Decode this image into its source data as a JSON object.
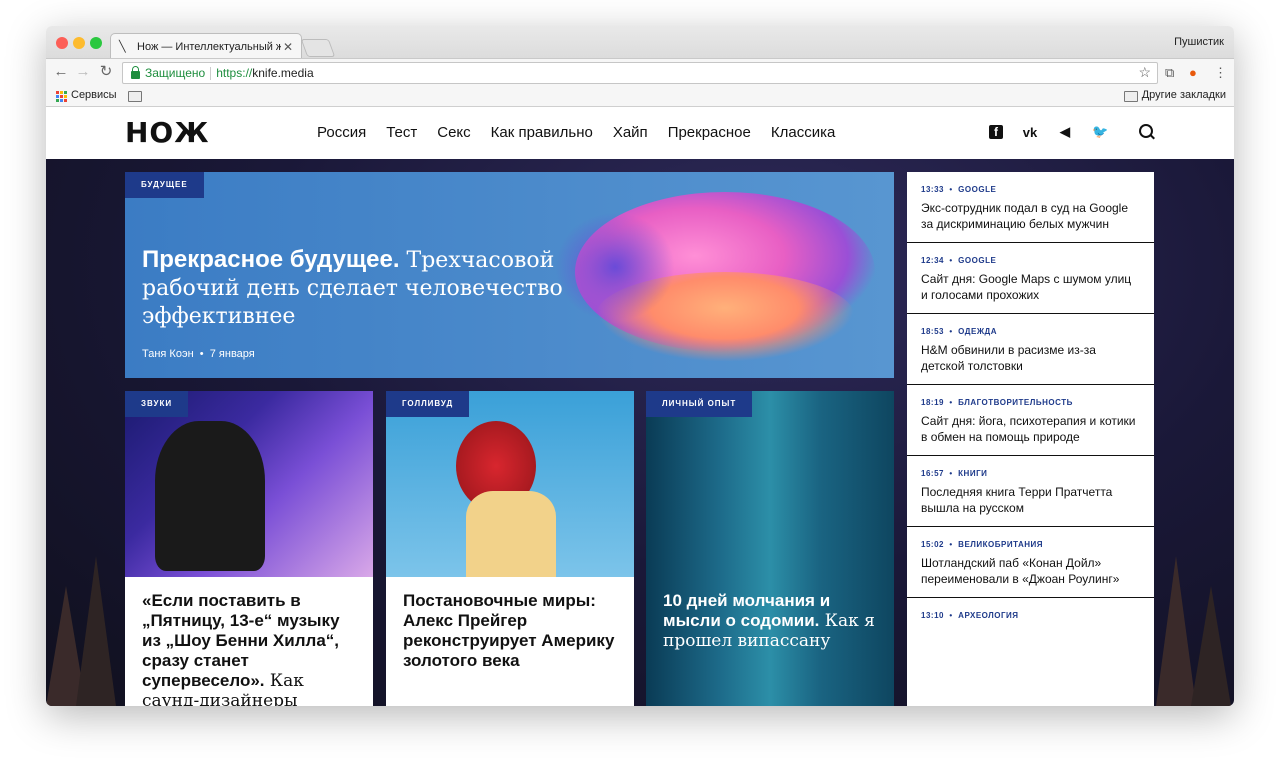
{
  "browser": {
    "tab_title": "Нож — Интеллектуальный ж",
    "tab_favicon": "knife-icon",
    "profile_name": "Пушистик",
    "secure_label": "Защищено",
    "url_scheme": "https://",
    "url_host": "knife.media",
    "bookmarks_apps_label": "Сервисы",
    "other_bookmarks_label": "Другие закладки"
  },
  "site": {
    "logo": "НОЖ",
    "nav": [
      "Россия",
      "Тест",
      "Секс",
      "Как правильно",
      "Хайп",
      "Прекрасное",
      "Классика"
    ],
    "social": {
      "facebook": "f",
      "vk": "vk",
      "telegram": "◀",
      "twitter": "🐦"
    }
  },
  "hero": {
    "tag": "будущее",
    "title_bold": "Прекрасное будущее.",
    "title_rest": " Трехчасовой рабочий день сделает человечество эффективнее",
    "author": "Таня Коэн",
    "date": "7 января"
  },
  "cards": [
    {
      "tag": "звуки",
      "title": "«Если поставить в „Пятницу, 13-е“ музыку из „Шоу Бенни Хилла“, сразу станет супервесело».",
      "subtitle": " Как саунд-дизайнеры"
    },
    {
      "tag": "голливуд",
      "title": "Постановочные миры: Алекс Прейгер реконструирует Америку золотого века",
      "subtitle": ""
    },
    {
      "tag": "личный опыт",
      "title": "10 дней молчания и мысли о содомии.",
      "subtitle": " Как я прошел випассану"
    }
  ],
  "news": [
    {
      "time": "13:33",
      "category": "GOOGLE",
      "title": "Экс-сотрудник подал в суд на Google за дискриминацию белых мужчин"
    },
    {
      "time": "12:34",
      "category": "GOOGLE",
      "title": "Сайт дня: Google Maps с шумом улиц и голосами прохожих"
    },
    {
      "time": "18:53",
      "category": "ОДЕЖДА",
      "title": "H&M обвинили в расизме из-за детской толстовки"
    },
    {
      "time": "18:19",
      "category": "БЛАГОТВОРИТЕЛЬНОСТЬ",
      "title": "Сайт дня: йога, психотерапия и котики в обмен на помощь природе"
    },
    {
      "time": "16:57",
      "category": "КНИГИ",
      "title": "Последняя книга Терри Пратчетта вышла на русском"
    },
    {
      "time": "15:02",
      "category": "ВЕЛИКОБРИТАНИЯ",
      "title": "Шотландский паб «Конан Дойл» переименовали в «Джоан Роулинг»"
    },
    {
      "time": "13:10",
      "category": "АРХЕОЛОГИЯ",
      "title": ""
    }
  ],
  "colors": {
    "tag_bg": "#1e3a8a",
    "secure_green": "#1e8e3e",
    "hero_bg": "#3b7cc4"
  }
}
